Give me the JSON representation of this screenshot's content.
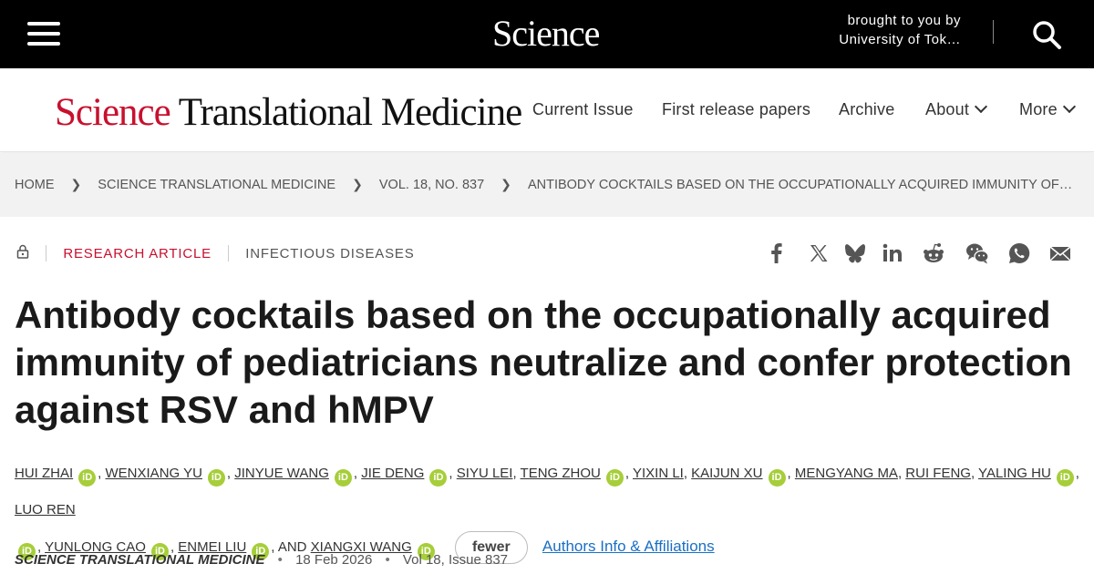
{
  "topbar": {
    "logo": "Science",
    "access_line1": "brought to you by",
    "access_line2": "University of Tok…",
    "menu_icon": "hamburger-menu-icon",
    "search_icon": "search-icon"
  },
  "journal": {
    "logo_science": "Science",
    "logo_rest": "Translational Medicine",
    "nav": {
      "current_issue": "Current Issue",
      "first_release": "First release papers",
      "archive": "Archive",
      "about": "About",
      "more": "More"
    }
  },
  "breadcrumb": {
    "home": "HOME",
    "journal": "SCIENCE TRANSLATIONAL MEDICINE",
    "volume": "VOL. 18, NO. 837",
    "article": "ANTIBODY COCKTAILS BASED ON THE OCCUPATIONALLY ACQUIRED IMMUNITY OF…"
  },
  "article": {
    "type": "RESEARCH ARTICLE",
    "subject": "INFECTIOUS DISEASES",
    "title": "Antibody cocktails based on the occupationally acquired immunity of pediatricians neutralize and confer protection against RSV and hMPV",
    "authors": [
      "HUI ZHAI",
      "WENXIANG YU",
      "JINYUE WANG",
      "JIE DENG",
      "SIYU LEI",
      "TENG ZHOU",
      "YIXIN LI",
      "KAIJUN XU",
      "MENGYANG MA",
      "RUI FENG",
      "YALING HU",
      "LUO REN",
      "YUNLONG CAO",
      "ENMEI LIU",
      "XIANGXI WANG"
    ],
    "and_text": "AND",
    "orcid_label": "iD",
    "fewer_label": "fewer",
    "affiliations_label": "Authors Info & Affiliations",
    "journal_name": "SCIENCE TRANSLATIONAL MEDICINE",
    "date": "18 Feb 2026",
    "issue": "Vol 18, Issue 837",
    "meta_sep": "•"
  },
  "share_icons": [
    "facebook-icon",
    "x-twitter-icon",
    "bluesky-icon",
    "linkedin-icon",
    "reddit-icon",
    "wechat-icon",
    "whatsapp-icon",
    "email-icon"
  ],
  "colors": {
    "brand_red": "#c8102e",
    "link_blue": "#1a6fc4",
    "orcid_green": "#a6ce39",
    "topbar": "#000000"
  }
}
